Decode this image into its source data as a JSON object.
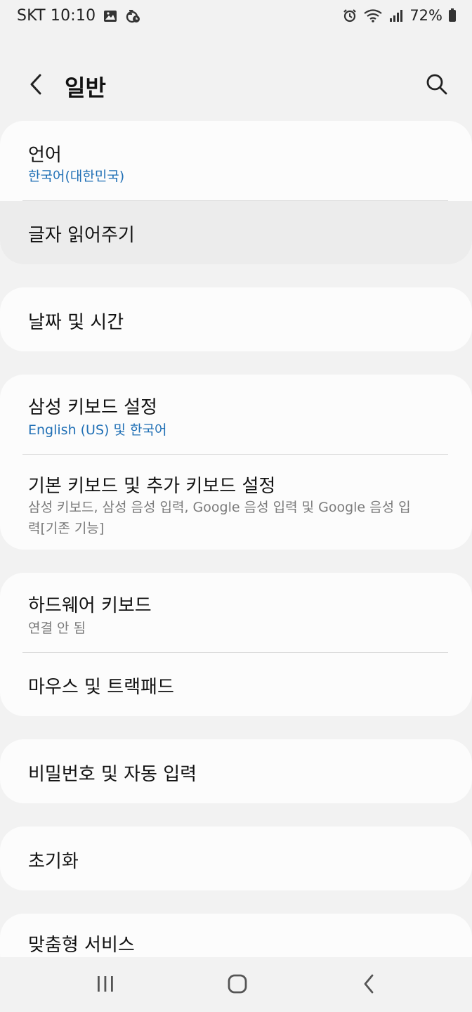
{
  "status_bar": {
    "carrier_time": "SKT 10:10",
    "left_icons": [
      "gallery-icon",
      "do-not-disturb-icon"
    ],
    "right_icons": [
      "alarm-icon",
      "wifi-icon",
      "signal-icon"
    ],
    "battery": "72%"
  },
  "header": {
    "title": "일반",
    "back_icon": "chevron-left-icon",
    "search_icon": "search-icon"
  },
  "groups": {
    "language": {
      "title": "언어",
      "subtitle": "한국어(대한민국)"
    },
    "tts": {
      "title": "글자 읽어주기"
    },
    "datetime": {
      "title": "날짜 및 시간"
    },
    "samsung_keyboard": {
      "title": "삼성 키보드 설정",
      "subtitle": "English (US) 및 한국어"
    },
    "default_keyboard": {
      "title": "기본 키보드 및 추가 키보드 설정",
      "subtitle": "삼성 키보드, 삼성 음성 입력, Google 음성 입력 및 Google 음성 입력[기존 기능]"
    },
    "hardware_keyboard": {
      "title": "하드웨어 키보드",
      "subtitle": "연결 안 됨"
    },
    "mouse": {
      "title": "마우스 및 트랙패드"
    },
    "passwords": {
      "title": "비밀번호 및 자동 입력"
    },
    "reset": {
      "title": "초기화"
    },
    "custom_service": {
      "title": "맞춤형 서비스"
    }
  },
  "nav_bar": {
    "recents_icon": "recents-icon",
    "home_icon": "home-icon",
    "back_icon": "back-icon"
  },
  "colors": {
    "background": "#f2f2f2",
    "card": "#fcfcfc",
    "accent": "#1f6fb5",
    "secondary_text": "#7a7a7a"
  }
}
